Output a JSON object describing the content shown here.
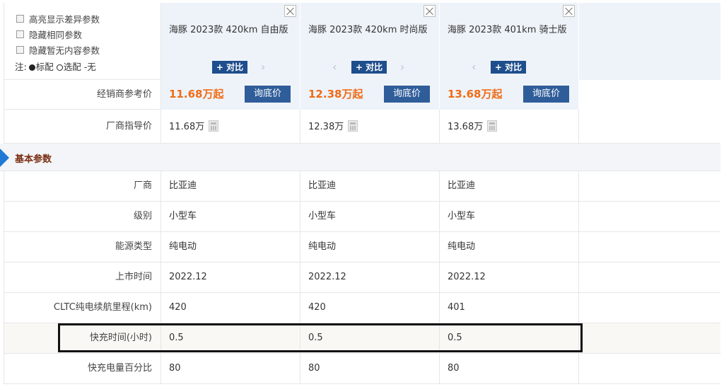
{
  "options": [
    {
      "label": "高亮显示差异参数"
    },
    {
      "label": "隐藏相同参数"
    },
    {
      "label": "隐藏暂无内容参数"
    }
  ],
  "legend": {
    "prefix": "注:",
    "standard": "标配",
    "optional": "选配",
    "none": "-无"
  },
  "cars": [
    {
      "name": "海豚 2023款 420km 自由版",
      "compare": "+ 对比",
      "dealer_price": "11.68万起",
      "msrp": "11.68万",
      "maker": "比亚迪",
      "level": "小型车",
      "energy": "纯电动",
      "launch": "2022.12",
      "range": "420",
      "fast_charge_time": "0.5",
      "fast_charge_pct": "80"
    },
    {
      "name": "海豚 2023款 420km 时尚版",
      "compare": "+ 对比",
      "dealer_price": "12.38万起",
      "msrp": "12.38万",
      "maker": "比亚迪",
      "level": "小型车",
      "energy": "纯电动",
      "launch": "2022.12",
      "range": "420",
      "fast_charge_time": "0.5",
      "fast_charge_pct": "80"
    },
    {
      "name": "海豚 2023款 401km 骑士版",
      "compare": "+ 对比",
      "dealer_price": "13.68万起",
      "msrp": "13.68万",
      "maker": "比亚迪",
      "level": "小型车",
      "energy": "纯电动",
      "launch": "2022.12",
      "range": "401",
      "fast_charge_time": "0.5",
      "fast_charge_pct": "80"
    }
  ],
  "ask_label": "询底价",
  "labels": {
    "dealer_price": "经销商参考价",
    "msrp": "厂商指导价",
    "section": "基本参数",
    "maker": "厂商",
    "level": "级别",
    "energy": "能源类型",
    "launch": "上市时间",
    "range": "CLTC纯电续航里程(km)",
    "fast_charge_time": "快充时间(小时)",
    "fast_charge_pct": "快充电量百分比"
  },
  "colors": {
    "price": "#f06b16",
    "button": "#2f5d9a",
    "section_title": "#7a2e12",
    "section_marker": "#1f7ad6",
    "header_bg": "#eef3f9"
  }
}
